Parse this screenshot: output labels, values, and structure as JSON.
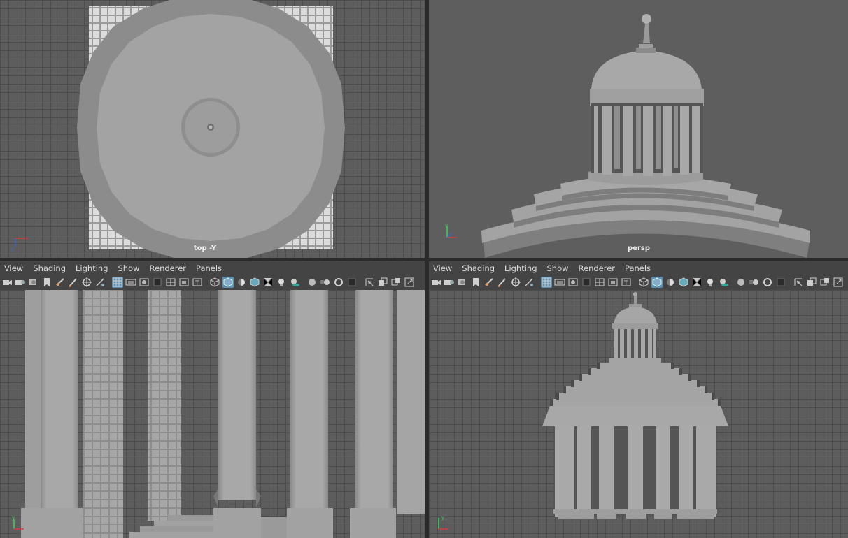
{
  "viewports": {
    "top_left": {
      "camera_label": "top -Y"
    },
    "top_right": {
      "camera_label": "persp"
    },
    "bottom_left": {
      "camera_label": ""
    },
    "bottom_right": {
      "camera_label": ""
    }
  },
  "panel_menu": [
    "View",
    "Shading",
    "Lighting",
    "Show",
    "Renderer",
    "Panels"
  ],
  "panel_toolbar_icons": [
    "camera-select-icon",
    "camera-attributes-icon",
    "camera-bookmark-icon",
    "image-plane-icon",
    "bookmark-icon",
    "grease-pencil-icon",
    "two-d-pan-zoom-icon",
    "uv-edit-icon",
    "grid-icon",
    "film-gate-icon",
    "resolution-gate-icon",
    "gate-mask-icon",
    "field-chart-icon",
    "safe-action-icon",
    "safe-title-icon",
    "wireframe-icon",
    "smooth-shade-icon",
    "default-material-icon",
    "wireframe-on-shaded-icon",
    "textured-icon",
    "use-lights-icon",
    "shadows-icon",
    "screen-space-ao-icon",
    "motion-blur-icon",
    "multisample-aa-icon",
    "depth-of-field-icon",
    "isolate-select-icon",
    "xray-icon",
    "xray-joints-icon",
    "xray-components-icon"
  ],
  "axes": {
    "x_color": "#d23c3c",
    "y_color": "#3cd25a",
    "z_color": "#3c64d2"
  },
  "colors": {
    "active_icon": "#5d8fb3",
    "menu_bg": "#444444",
    "grid_bg": "#5d5d5d"
  }
}
